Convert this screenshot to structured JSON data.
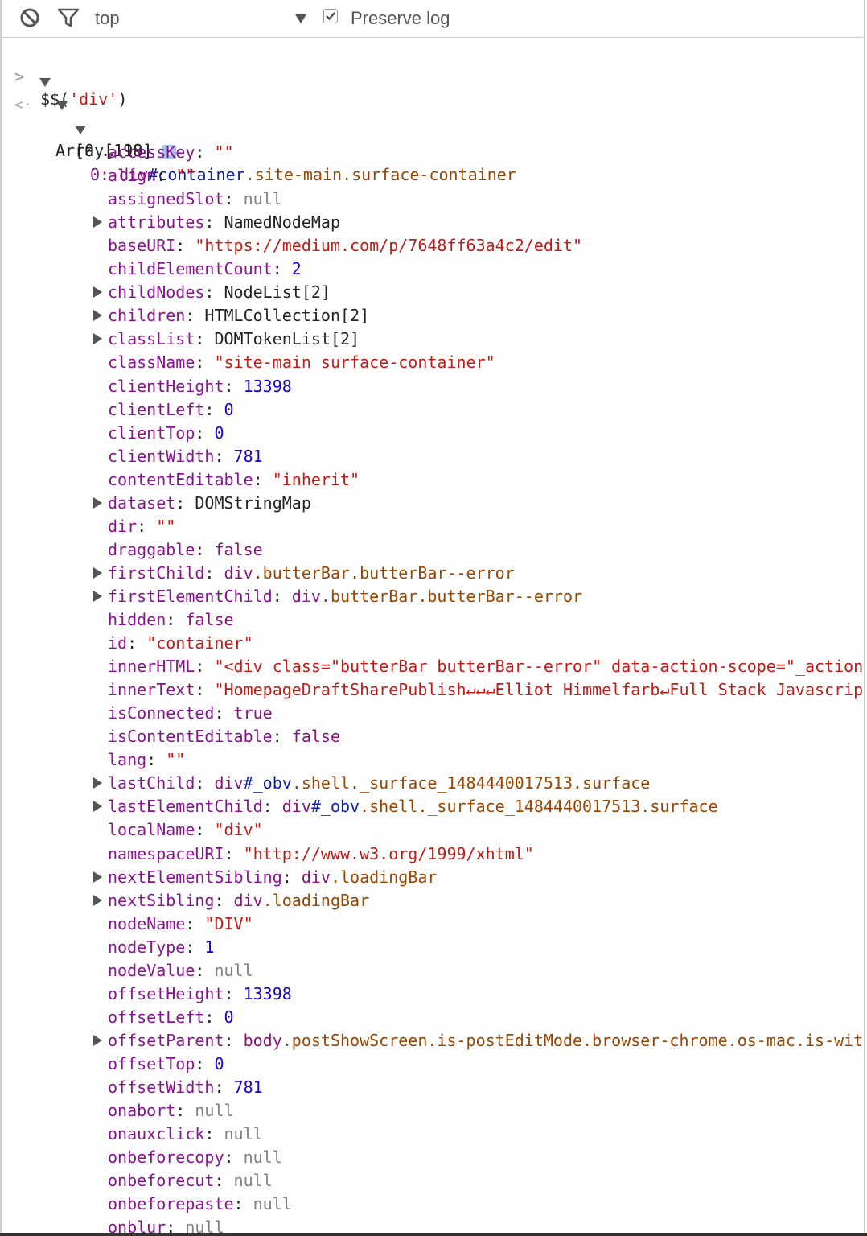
{
  "toolbar": {
    "context": "top",
    "preserve_log_label": "Preserve log",
    "preserve_log_checked": true,
    "icons": [
      "clear-console-icon",
      "filter-icon",
      "chevron-down-icon",
      "checkbox-icon"
    ]
  },
  "console": {
    "input_prompt": ">",
    "command": "$$('div')",
    "command_prefix": "$$(",
    "command_arg": "'div'",
    "command_suffix": ")",
    "result_prompt": "<·",
    "result_type": "Array[118]",
    "info_badge": "i",
    "range_label": "[0 … 99]",
    "first_item_index": "0",
    "first_item_tag": "div",
    "first_item_id": "#container",
    "first_item_classes": ".site-main.surface-container",
    "properties": [
      {
        "key": "accessKey",
        "value": "\"\"",
        "type": "s",
        "expandable": false
      },
      {
        "key": "align",
        "value": "\"\"",
        "type": "s",
        "expandable": false
      },
      {
        "key": "assignedSlot",
        "value": "null",
        "type": "nl",
        "expandable": false
      },
      {
        "key": "attributes",
        "value": "NamedNodeMap",
        "type": "o",
        "expandable": true
      },
      {
        "key": "baseURI",
        "value": "\"https://medium.com/p/7648ff63a4c2/edit\"",
        "type": "s",
        "expandable": false
      },
      {
        "key": "childElementCount",
        "value": "2",
        "type": "n",
        "expandable": false
      },
      {
        "key": "childNodes",
        "value": "NodeList[2]",
        "type": "o",
        "expandable": true
      },
      {
        "key": "children",
        "value": "HTMLCollection[2]",
        "type": "o",
        "expandable": true
      },
      {
        "key": "classList",
        "value": "DOMTokenList[2]",
        "type": "o",
        "expandable": true
      },
      {
        "key": "className",
        "value": "\"site-main surface-container\"",
        "type": "s",
        "expandable": false
      },
      {
        "key": "clientHeight",
        "value": "13398",
        "type": "n",
        "expandable": false
      },
      {
        "key": "clientLeft",
        "value": "0",
        "type": "n",
        "expandable": false
      },
      {
        "key": "clientTop",
        "value": "0",
        "type": "n",
        "expandable": false
      },
      {
        "key": "clientWidth",
        "value": "781",
        "type": "n",
        "expandable": false
      },
      {
        "key": "contentEditable",
        "value": "\"inherit\"",
        "type": "s",
        "expandable": false
      },
      {
        "key": "dataset",
        "value": "DOMStringMap",
        "type": "o",
        "expandable": true
      },
      {
        "key": "dir",
        "value": "\"\"",
        "type": "s",
        "expandable": false
      },
      {
        "key": "draggable",
        "value": "false",
        "type": "t",
        "expandable": false
      },
      {
        "key": "firstChild",
        "tag": "div",
        "cls": ".butterBar.butterBar--error",
        "type": "el",
        "expandable": true
      },
      {
        "key": "firstElementChild",
        "tag": "div",
        "cls": ".butterBar.butterBar--error",
        "type": "el",
        "expandable": true
      },
      {
        "key": "hidden",
        "value": "false",
        "type": "t",
        "expandable": false
      },
      {
        "key": "id",
        "value": "\"container\"",
        "type": "s",
        "expandable": false
      },
      {
        "key": "innerHTML",
        "value": "\"<div class=\"butterBar butterBar--error\" data-action-scope=\"_actionsc",
        "type": "s",
        "expandable": false
      },
      {
        "key": "innerText",
        "value": "\"HomepageDraftSharePublish↵↵↵Elliot Himmelfarb↵Full Stack Javascript",
        "type": "s",
        "expandable": false
      },
      {
        "key": "isConnected",
        "value": "true",
        "type": "t",
        "expandable": false
      },
      {
        "key": "isContentEditable",
        "value": "false",
        "type": "t",
        "expandable": false
      },
      {
        "key": "lang",
        "value": "\"\"",
        "type": "s",
        "expandable": false
      },
      {
        "key": "lastChild",
        "tag": "div",
        "id": "#_obv",
        "cls": ".shell._surface_1484440017513.surface",
        "type": "el",
        "expandable": true
      },
      {
        "key": "lastElementChild",
        "tag": "div",
        "id": "#_obv",
        "cls": ".shell._surface_1484440017513.surface",
        "type": "el",
        "expandable": true
      },
      {
        "key": "localName",
        "value": "\"div\"",
        "type": "s",
        "expandable": false
      },
      {
        "key": "namespaceURI",
        "value": "\"http://www.w3.org/1999/xhtml\"",
        "type": "s",
        "expandable": false
      },
      {
        "key": "nextElementSibling",
        "tag": "div",
        "cls": ".loadingBar",
        "type": "el",
        "expandable": true
      },
      {
        "key": "nextSibling",
        "tag": "div",
        "cls": ".loadingBar",
        "type": "el",
        "expandable": true
      },
      {
        "key": "nodeName",
        "value": "\"DIV\"",
        "type": "s",
        "expandable": false
      },
      {
        "key": "nodeType",
        "value": "1",
        "type": "n",
        "expandable": false
      },
      {
        "key": "nodeValue",
        "value": "null",
        "type": "nl",
        "expandable": false
      },
      {
        "key": "offsetHeight",
        "value": "13398",
        "type": "n",
        "expandable": false
      },
      {
        "key": "offsetLeft",
        "value": "0",
        "type": "n",
        "expandable": false
      },
      {
        "key": "offsetParent",
        "tag": "body",
        "cls": ".postShowScreen.is-postEditMode.browser-chrome.os-mac.is-withM",
        "type": "el",
        "expandable": true
      },
      {
        "key": "offsetTop",
        "value": "0",
        "type": "n",
        "expandable": false
      },
      {
        "key": "offsetWidth",
        "value": "781",
        "type": "n",
        "expandable": false
      },
      {
        "key": "onabort",
        "value": "null",
        "type": "nl",
        "expandable": false
      },
      {
        "key": "onauxclick",
        "value": "null",
        "type": "nl",
        "expandable": false
      },
      {
        "key": "onbeforecopy",
        "value": "null",
        "type": "nl",
        "expandable": false
      },
      {
        "key": "onbeforecut",
        "value": "null",
        "type": "nl",
        "expandable": false
      },
      {
        "key": "onbeforepaste",
        "value": "null",
        "type": "nl",
        "expandable": false
      },
      {
        "key": "onblur",
        "value": "null",
        "type": "nl",
        "expandable": false
      }
    ]
  }
}
